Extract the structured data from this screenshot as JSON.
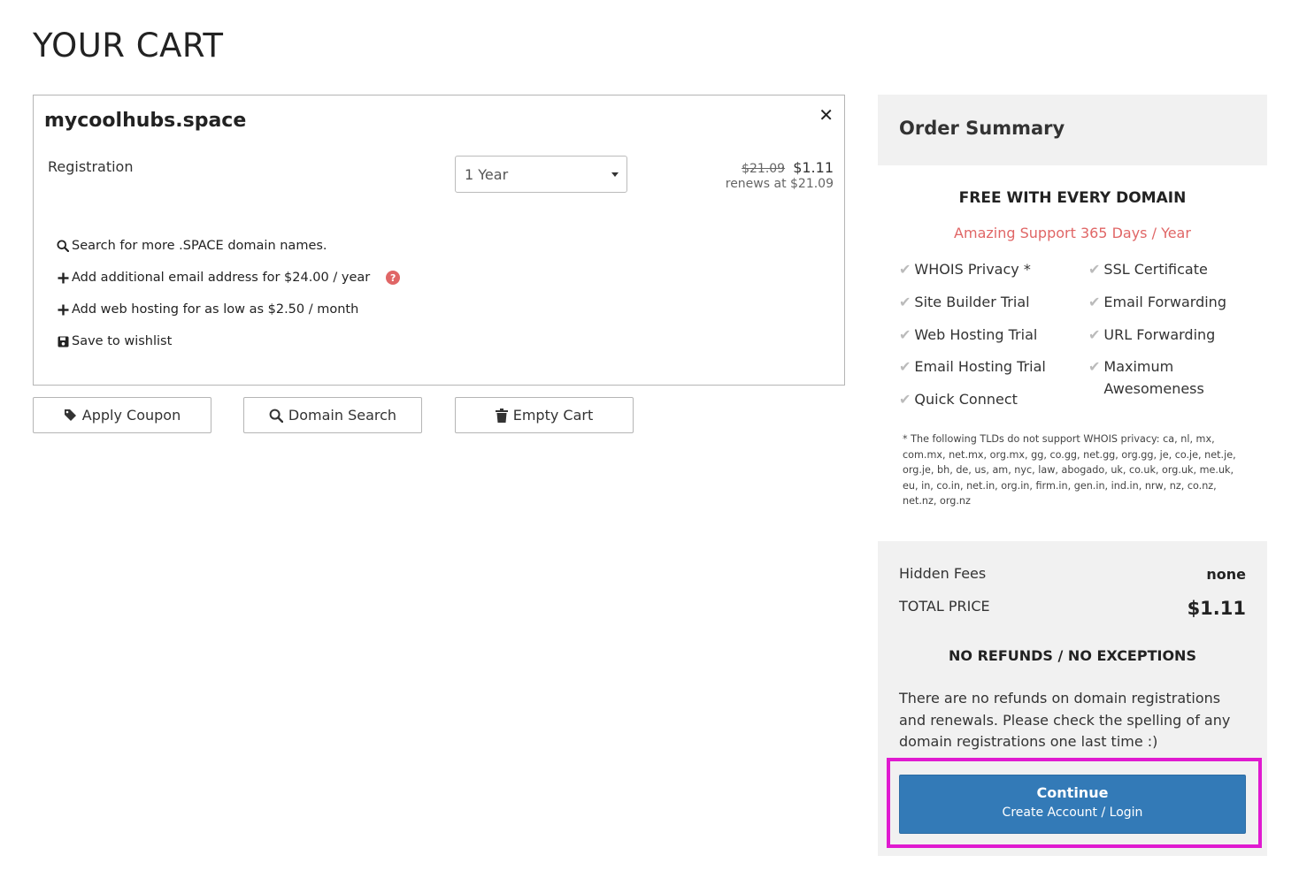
{
  "page": {
    "title": "YOUR CART"
  },
  "cart_item": {
    "domain": "mycoolhubs.space",
    "registration_label": "Registration",
    "period": "1 Year",
    "old_price": "$21.09",
    "price": "$1.11",
    "renews": "renews at $21.09",
    "actions": {
      "search": "Search for more .SPACE domain names.",
      "email": "Add additional email address for $24.00 / year",
      "hosting": "Add web hosting for as low as $2.50 / month",
      "wishlist": "Save to wishlist"
    }
  },
  "buttons": {
    "apply_coupon": "Apply Coupon",
    "domain_search": "Domain Search",
    "empty_cart": "Empty Cart"
  },
  "summary": {
    "title": "Order Summary",
    "free_title": "FREE WITH EVERY DOMAIN",
    "support": "Amazing Support 365 Days / Year",
    "features_left": [
      "WHOIS Privacy *",
      "Site Builder Trial",
      "Web Hosting Trial",
      "Email Hosting Trial",
      "Quick Connect"
    ],
    "features_right": [
      "SSL Certificate",
      "Email Forwarding",
      "URL Forwarding",
      "Maximum Awesomeness"
    ],
    "footnote": "* The following TLDs do not support WHOIS privacy: ca, nl, mx, com.mx, net.mx, org.mx, gg, co.gg, net.gg, org.gg, je, co.je, net.je, org.je, bh, de, us, am, nyc, law, abogado, uk, co.uk, org.uk, me.uk, eu, in, co.in, net.in, org.in, firm.in, gen.in, ind.in, nrw, nz, co.nz, net.nz, org.nz"
  },
  "totals": {
    "hidden_fees_label": "Hidden Fees",
    "hidden_fees_value": "none",
    "total_label": "TOTAL PRICE",
    "total_value": "$1.11",
    "norefund_title": "NO REFUNDS / NO EXCEPTIONS",
    "norefund_text": "There are no refunds on domain registrations and renewals. Please check the spelling of any domain registrations one last time :)"
  },
  "continue": {
    "label": "Continue",
    "sub": "Create Account / Login"
  },
  "colors": {
    "primary": "#337ab7",
    "highlight": "#e01ad0",
    "accent_red": "#e06666",
    "panel_bg": "#f1f1f1"
  }
}
